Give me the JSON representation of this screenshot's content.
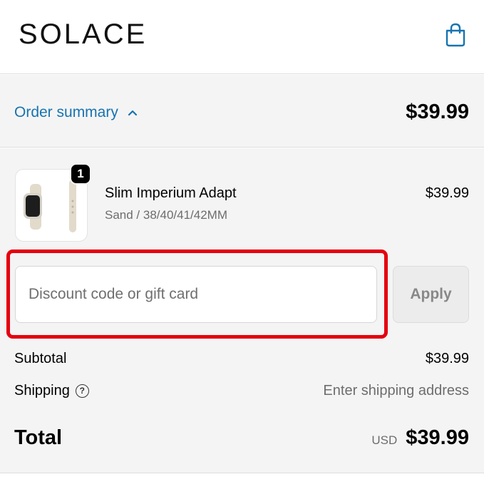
{
  "header": {
    "logo": "SOLACE",
    "cart_icon": "shopping-bag-icon",
    "accent_color": "#1773b0"
  },
  "summary": {
    "toggle_label": "Order summary",
    "toggle_icon": "chevron-up-icon",
    "total": "$39.99"
  },
  "line_item": {
    "quantity": "1",
    "name": "Slim Imperium Adapt",
    "variant": "Sand / 38/40/41/42MM",
    "price": "$39.99",
    "image_icon": "watch-band-image"
  },
  "discount": {
    "placeholder": "Discount code or gift card",
    "value": "",
    "apply_label": "Apply",
    "highlight_color": "#e5000f"
  },
  "totals": {
    "subtotal_label": "Subtotal",
    "subtotal_value": "$39.99",
    "shipping_label": "Shipping",
    "shipping_help_icon": "question-circle-icon",
    "shipping_value": "Enter shipping address",
    "total_label": "Total",
    "currency": "USD",
    "total_value": "$39.99"
  }
}
